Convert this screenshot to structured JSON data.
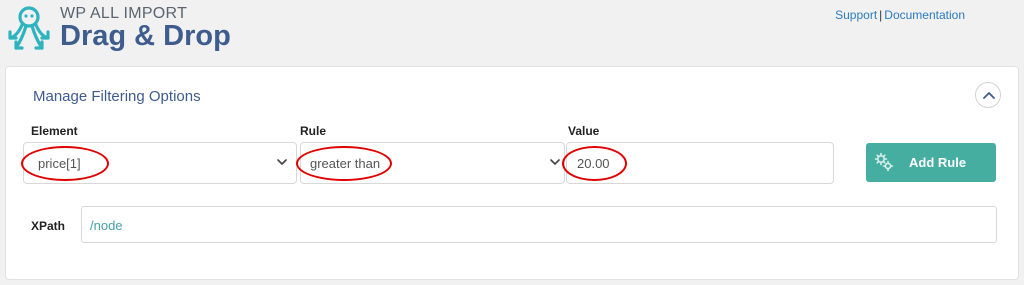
{
  "header": {
    "brand_small": "WP ALL IMPORT",
    "brand_big": "Drag & Drop",
    "support_link": "Support",
    "separator": "|",
    "documentation_link": "Documentation",
    "logo_icon": "octopus-logo-icon"
  },
  "panel": {
    "title": "Manage Filtering Options",
    "collapse_icon": "chevron-up-icon"
  },
  "filter": {
    "element_label": "Element",
    "element_value": "price[1]",
    "rule_label": "Rule",
    "rule_value": "greater than",
    "value_label": "Value",
    "value_value": "20.00",
    "add_button": "Add Rule",
    "add_button_icon": "gears-icon"
  },
  "xpath": {
    "label": "XPath",
    "value": "/node"
  },
  "colors": {
    "accent": "#46ada1",
    "title_blue": "#3f5c8e",
    "link_blue": "#2b7bbf",
    "highlight_red": "#e00000"
  }
}
